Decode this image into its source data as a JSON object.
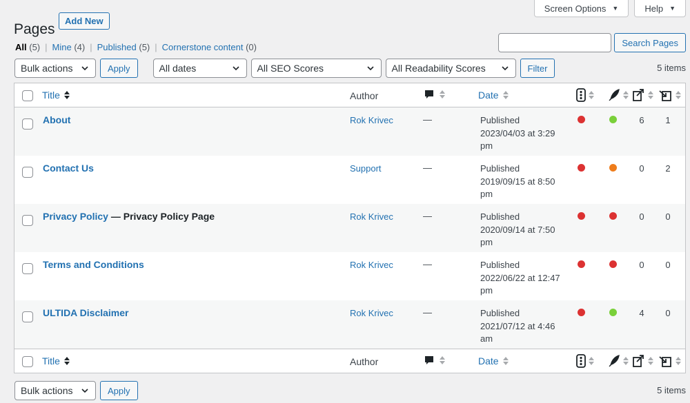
{
  "screen_tabs": {
    "screen_options": "Screen Options",
    "help": "Help"
  },
  "page": {
    "title": "Pages",
    "add_new": "Add New"
  },
  "views": [
    {
      "label": "All",
      "count": "(5)"
    },
    {
      "label": "Mine",
      "count": "(4)"
    },
    {
      "label": "Published",
      "count": "(5)"
    },
    {
      "label": "Cornerstone content",
      "count": "(0)"
    }
  ],
  "search": {
    "button": "Search Pages",
    "value": ""
  },
  "filters": {
    "bulk_actions": "Bulk actions",
    "apply": "Apply",
    "dates": "All dates",
    "seo": "All SEO Scores",
    "readability": "All Readability Scores",
    "filter": "Filter",
    "items_count": "5 items"
  },
  "columns": {
    "title": "Title",
    "author": "Author",
    "date": "Date"
  },
  "colors": {
    "red": "#dc3232",
    "green": "#7ad03a",
    "orange": "#ee7c1b",
    "link": "#2271b1"
  },
  "rows": [
    {
      "title": "About",
      "state": "",
      "author": "Rok Krivec",
      "comments": "—",
      "status": "Published",
      "date": "2023/04/03 at 3:29",
      "date2": "pm",
      "seo": "red",
      "readability": "green",
      "links": "6",
      "linked": "1"
    },
    {
      "title": "Contact Us",
      "state": "",
      "author": "Support",
      "comments": "—",
      "status": "Published",
      "date": "2019/09/15 at 8:50",
      "date2": "pm",
      "seo": "red",
      "readability": "orange",
      "links": "0",
      "linked": "2"
    },
    {
      "title": "Privacy Policy",
      "state": " — Privacy Policy Page",
      "author": "Rok Krivec",
      "comments": "—",
      "status": "Published",
      "date": "2020/09/14 at 7:50",
      "date2": "pm",
      "seo": "red",
      "readability": "red",
      "links": "0",
      "linked": "0"
    },
    {
      "title": "Terms and Conditions",
      "state": "",
      "author": "Rok Krivec",
      "comments": "—",
      "status": "Published",
      "date": "2022/06/22 at 12:47",
      "date2": "pm",
      "seo": "red",
      "readability": "red",
      "links": "0",
      "linked": "0"
    },
    {
      "title": "ULTIDA Disclaimer",
      "state": "",
      "author": "Rok Krivec",
      "comments": "—",
      "status": "Published",
      "date": "2021/07/12 at 4:46",
      "date2": "am",
      "seo": "red",
      "readability": "green",
      "links": "4",
      "linked": "0"
    }
  ]
}
